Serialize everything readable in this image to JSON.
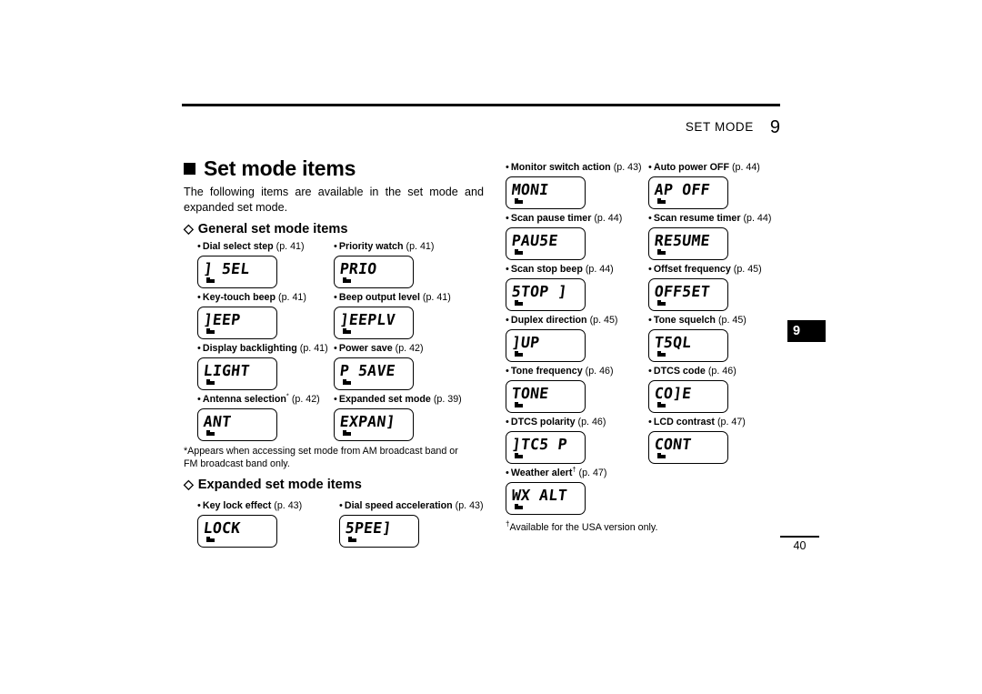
{
  "header": {
    "title": "SET MODE",
    "chapter": "9"
  },
  "section": {
    "title": "Set mode items",
    "intro": "The following items are available in the set mode and expanded set mode.",
    "general_heading": "General set mode items",
    "expanded_heading": "Expanded set mode items"
  },
  "general_items": [
    {
      "name": "Dial select step",
      "page": "(p. 41)",
      "lcd": "] 5EL",
      "marker": "note"
    },
    {
      "name": "Priority watch",
      "page": "(p. 41)",
      "lcd": "PRIO",
      "marker": "note"
    },
    {
      "name": "Key-touch beep",
      "page": "(p. 41)",
      "lcd": "]EEP",
      "marker": "note"
    },
    {
      "name": "Beep output level",
      "page": "(p. 41)",
      "lcd": "]EEPLV",
      "marker": "note"
    },
    {
      "name": "Display backlighting",
      "page": "(p. 41)",
      "lcd": "LIGHT",
      "marker": "note"
    },
    {
      "name": "Power save",
      "page": "(p. 42)",
      "lcd": "P 5AVE",
      "marker": "note"
    },
    {
      "name": "Antenna selection",
      "page": "(p. 42)",
      "lcd": "ANT",
      "marker": "note",
      "sup": "*"
    },
    {
      "name": "Expanded set mode",
      "page": "(p. 39)",
      "lcd": "EXPAN]",
      "marker": "note"
    },
    {
      "name": "Monitor switch action",
      "page": "(p. 43)",
      "lcd": "MONI",
      "marker": "note"
    },
    {
      "name": "Auto power OFF",
      "page": "(p. 44)",
      "lcd": "AP OFF",
      "marker": "note"
    },
    {
      "name": "Scan pause timer",
      "page": "(p. 44)",
      "lcd": "PAU5E",
      "marker": "note"
    },
    {
      "name": "Scan resume timer",
      "page": "(p. 44)",
      "lcd": "RE5UME",
      "marker": "note"
    },
    {
      "name": "Scan stop beep",
      "page": "(p. 44)",
      "lcd": "5TOP ]",
      "marker": "note"
    },
    {
      "name": "Offset frequency",
      "page": "(p. 45)",
      "lcd": "OFF5ET",
      "marker": "note"
    },
    {
      "name": "Duplex direction",
      "page": "(p. 45)",
      "lcd": "]UP",
      "marker": "note"
    },
    {
      "name": "Tone squelch",
      "page": "(p. 45)",
      "lcd": "T5QL",
      "marker": "note"
    },
    {
      "name": "Tone frequency",
      "page": "(p. 46)",
      "lcd": "TONE",
      "marker": "note"
    },
    {
      "name": "DTCS code",
      "page": "(p. 46)",
      "lcd": "CO]E",
      "marker": "note"
    },
    {
      "name": "DTCS polarity",
      "page": "(p. 46)",
      "lcd": "]TC5 P",
      "marker": "note"
    },
    {
      "name": "LCD contrast",
      "page": "(p. 47)",
      "lcd": "CONT",
      "marker": "note"
    },
    {
      "name": "Weather alert",
      "page": "(p. 47)",
      "lcd": "WX ALT",
      "marker": "note",
      "sup": "†"
    }
  ],
  "expanded_items": [
    {
      "name": "Key lock effect",
      "page": "(p. 43)",
      "lcd": "LOCK",
      "marker": "note"
    },
    {
      "name": "Dial speed acceleration",
      "page": "(p. 43)",
      "lcd": "5PEE]",
      "marker": "note"
    }
  ],
  "footnotes": {
    "left": "*Appears when accessing set mode from AM broadcast band or FM broadcast band only.",
    "right_marker": "†",
    "right": "Available for the USA version only."
  },
  "chapter_tab": "9",
  "page_number": "40"
}
